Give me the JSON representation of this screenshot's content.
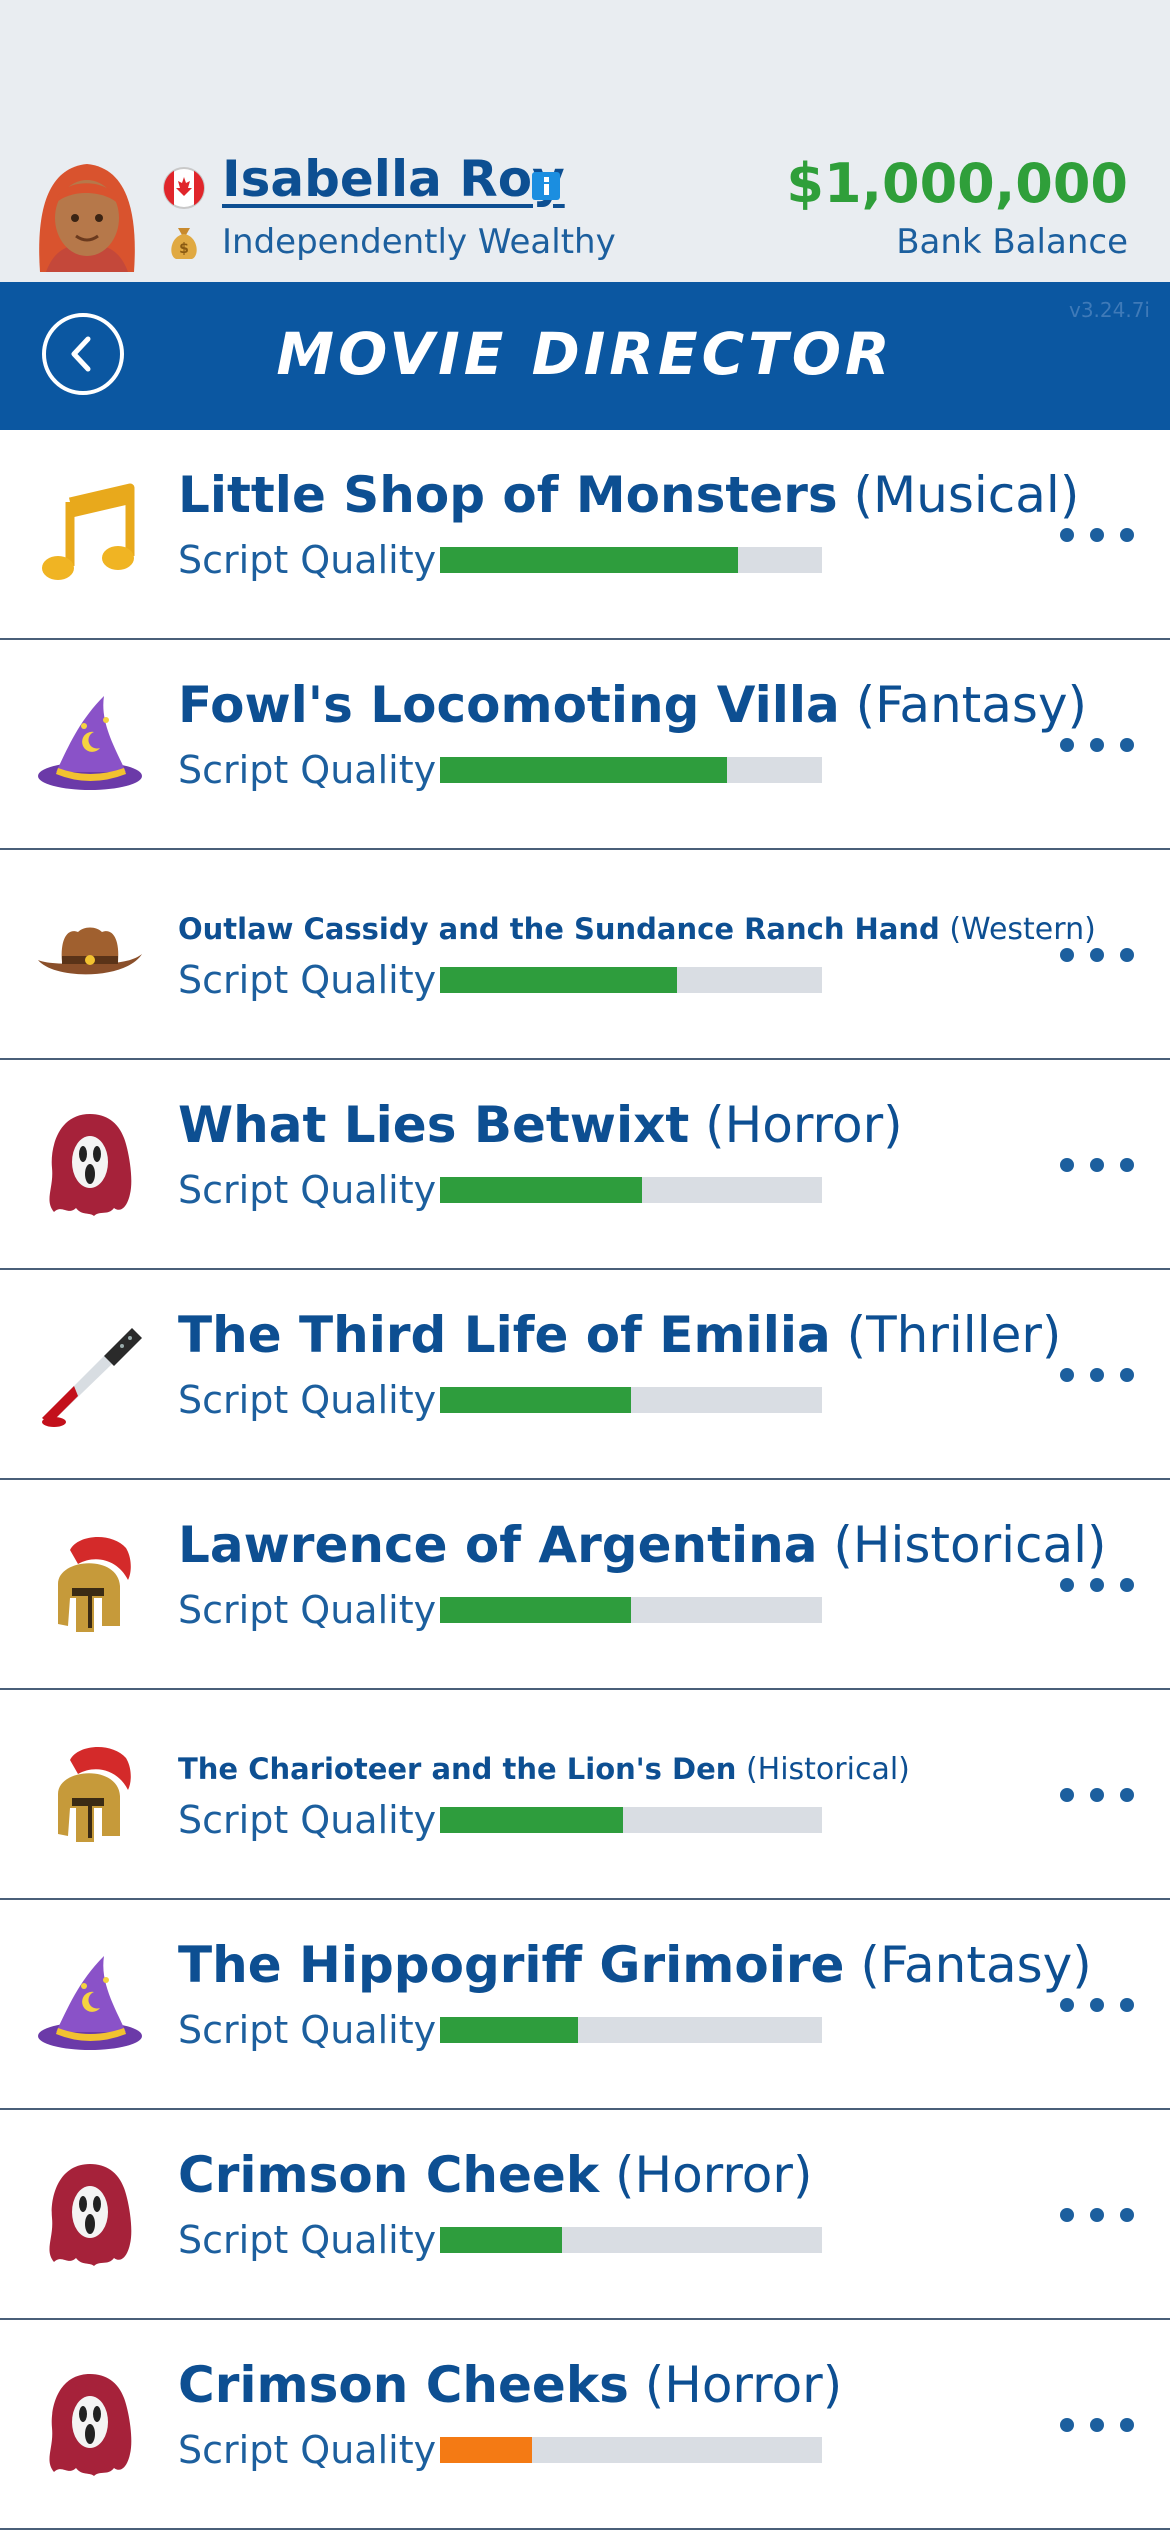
{
  "profile": {
    "name": "Isabella Roy",
    "status": "Independently Wealthy",
    "balance": "$1,000,000",
    "balance_label": "Bank Balance"
  },
  "header": {
    "title": "MOVIE DIRECTOR",
    "version": "v3.24.7i"
  },
  "colors": {
    "header_bg": "#0b57a1",
    "top_bg": "#e9edf1",
    "text_blue": "#0d4f92",
    "balance_green": "#2f9f3a",
    "bar_green": "#2e9d3d",
    "bar_orange": "#f47a14",
    "bar_track": "#d9dde3"
  },
  "scripts": [
    {
      "title": "Little Shop of Monsters",
      "genre": "(Musical)",
      "label": "Script Quality",
      "quality": 0.78,
      "icon": "musical-note-icon",
      "size": "big",
      "color": "green"
    },
    {
      "title": "Fowl's Locomoting Villa",
      "genre": "(Fantasy)",
      "label": "Script Quality",
      "quality": 0.75,
      "icon": "wizard-hat-icon",
      "size": "big",
      "color": "green"
    },
    {
      "title": "Outlaw Cassidy and the Sundance Ranch Hand",
      "genre": "(Western)",
      "label": "Script Quality",
      "quality": 0.62,
      "icon": "cowboy-hat-icon",
      "size": "small",
      "color": "green"
    },
    {
      "title": "What Lies Betwixt",
      "genre": "(Horror)",
      "label": "Script Quality",
      "quality": 0.53,
      "icon": "ghost-mask-icon",
      "size": "big",
      "color": "green"
    },
    {
      "title": "The Third Life of Emilia",
      "genre": "(Thriller)",
      "label": "Script Quality",
      "quality": 0.5,
      "icon": "bloody-knife-icon",
      "size": "big",
      "color": "green"
    },
    {
      "title": "Lawrence of Argentina",
      "genre": "(Historical)",
      "label": "Script Quality",
      "quality": 0.5,
      "icon": "spartan-helmet-icon",
      "size": "big",
      "color": "green"
    },
    {
      "title": "The Charioteer and the Lion's Den",
      "genre": "(Historical)",
      "label": "Script Quality",
      "quality": 0.48,
      "icon": "spartan-helmet-icon",
      "size": "small",
      "color": "green"
    },
    {
      "title": "The Hippogriff Grimoire",
      "genre": "(Fantasy)",
      "label": "Script Quality",
      "quality": 0.36,
      "icon": "wizard-hat-icon",
      "size": "big",
      "color": "green"
    },
    {
      "title": "Crimson Cheek",
      "genre": "(Horror)",
      "label": "Script Quality",
      "quality": 0.32,
      "icon": "ghost-mask-icon",
      "size": "big",
      "color": "green"
    },
    {
      "title": "Crimson Cheeks",
      "genre": "(Horror)",
      "label": "Script Quality",
      "quality": 0.24,
      "icon": "ghost-mask-icon",
      "size": "big",
      "color": "orange"
    }
  ]
}
